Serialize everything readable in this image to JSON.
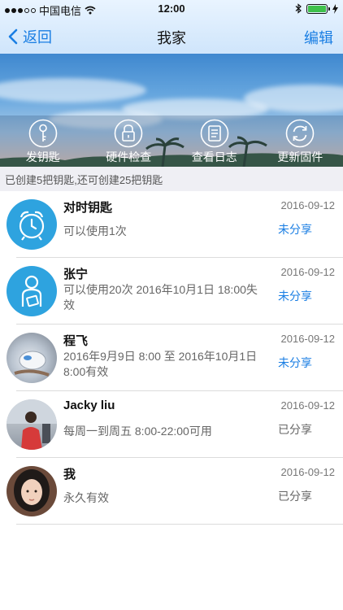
{
  "status_bar": {
    "carrier": "中国电信",
    "time": "12:00"
  },
  "nav": {
    "back_label": "返回",
    "title": "我家",
    "edit_label": "编辑"
  },
  "actions": [
    {
      "label": "发钥匙",
      "icon": "key-icon"
    },
    {
      "label": "硬件检查",
      "icon": "lock-icon"
    },
    {
      "label": "查看日志",
      "icon": "log-icon"
    },
    {
      "label": "更新固件",
      "icon": "refresh-icon"
    }
  ],
  "info_text": "已创建5把钥匙,还可创建25把钥匙",
  "keys": [
    {
      "name": "对时钥匙",
      "desc": "可以使用1次",
      "date": "2016-09-12",
      "share": "未分享"
    },
    {
      "name": "张宁",
      "desc": "可以使用20次 2016年10月1日 18:00失效",
      "date": "2016-09-12",
      "share": "未分享"
    },
    {
      "name": "程飞",
      "desc": "2016年9月9日 8:00 至 2016年10月1日 8:00有效",
      "date": "2016-09-12",
      "share": "未分享"
    },
    {
      "name": "Jacky liu",
      "desc": "每周一到周五 8:00-22:00可用",
      "date": "2016-09-12",
      "share": "已分享"
    },
    {
      "name": "我",
      "desc": "永久有效",
      "date": "2016-09-12",
      "share": "已分享"
    }
  ],
  "colors": {
    "accent": "#1a7ee3",
    "avatar_blue": "#2ea3df"
  }
}
